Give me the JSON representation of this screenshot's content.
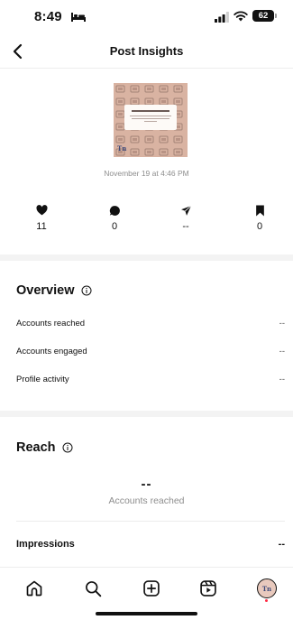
{
  "status_bar": {
    "time": "8:49",
    "battery": "62"
  },
  "header": {
    "title": "Post Insights"
  },
  "post": {
    "date": "November 19 at 4:46 PM",
    "thumbnail_logo": "Tn"
  },
  "stats": [
    {
      "icon": "heart-icon",
      "value": "11"
    },
    {
      "icon": "comment-icon",
      "value": "0"
    },
    {
      "icon": "share-icon",
      "value": "--"
    },
    {
      "icon": "save-icon",
      "value": "0"
    }
  ],
  "overview": {
    "title": "Overview",
    "rows": [
      {
        "label": "Accounts reached",
        "value": "--"
      },
      {
        "label": "Accounts engaged",
        "value": "--"
      },
      {
        "label": "Profile activity",
        "value": "--"
      }
    ]
  },
  "reach": {
    "title": "Reach",
    "value": "--",
    "label": "Accounts reached"
  },
  "impressions": {
    "label": "Impressions",
    "value": "--"
  },
  "tab_bar": {
    "items": [
      "home-icon",
      "search-icon",
      "create-icon",
      "reels-icon",
      "profile-avatar"
    ],
    "avatar_text": "Tn"
  },
  "colors": {
    "accent_dot": "#ff2b44",
    "thumbnail_bg": "#d9b3a2"
  }
}
